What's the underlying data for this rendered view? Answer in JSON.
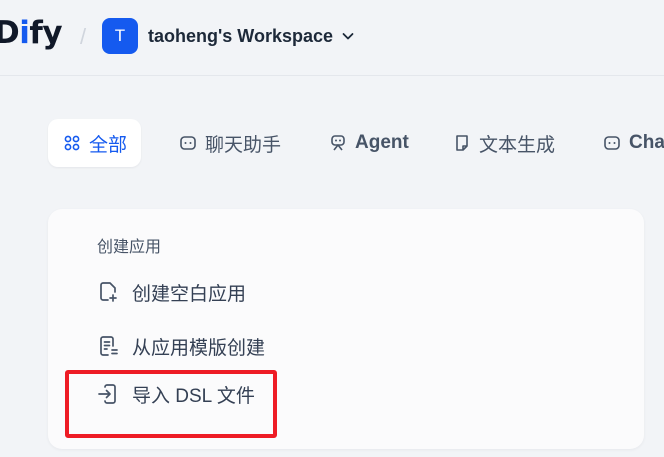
{
  "header": {
    "logo_prefix": "D",
    "logo_highlight": "i",
    "logo_suffix": "fy",
    "separator": "/",
    "workspace_initial": "T",
    "workspace_name": "taoheng's Workspace"
  },
  "tabs": [
    {
      "label": "全部",
      "icon": "grid-icon",
      "active": true
    },
    {
      "label": "聊天助手",
      "icon": "chat-bubble-icon"
    },
    {
      "label": "Agent",
      "icon": "robot-icon"
    },
    {
      "label": "文本生成",
      "icon": "document-icon"
    },
    {
      "label": "Chat",
      "icon": "chat-bubble-icon"
    }
  ],
  "create_panel": {
    "title": "创建应用",
    "items": [
      {
        "label": "创建空白应用",
        "icon": "file-plus-icon"
      },
      {
        "label": "从应用模版创建",
        "icon": "file-template-icon"
      },
      {
        "label": "导入 DSL 文件",
        "icon": "import-icon"
      }
    ]
  },
  "colors": {
    "accent": "#155aef",
    "highlight_border": "#ee1c25",
    "background": "#f2f4f7"
  }
}
